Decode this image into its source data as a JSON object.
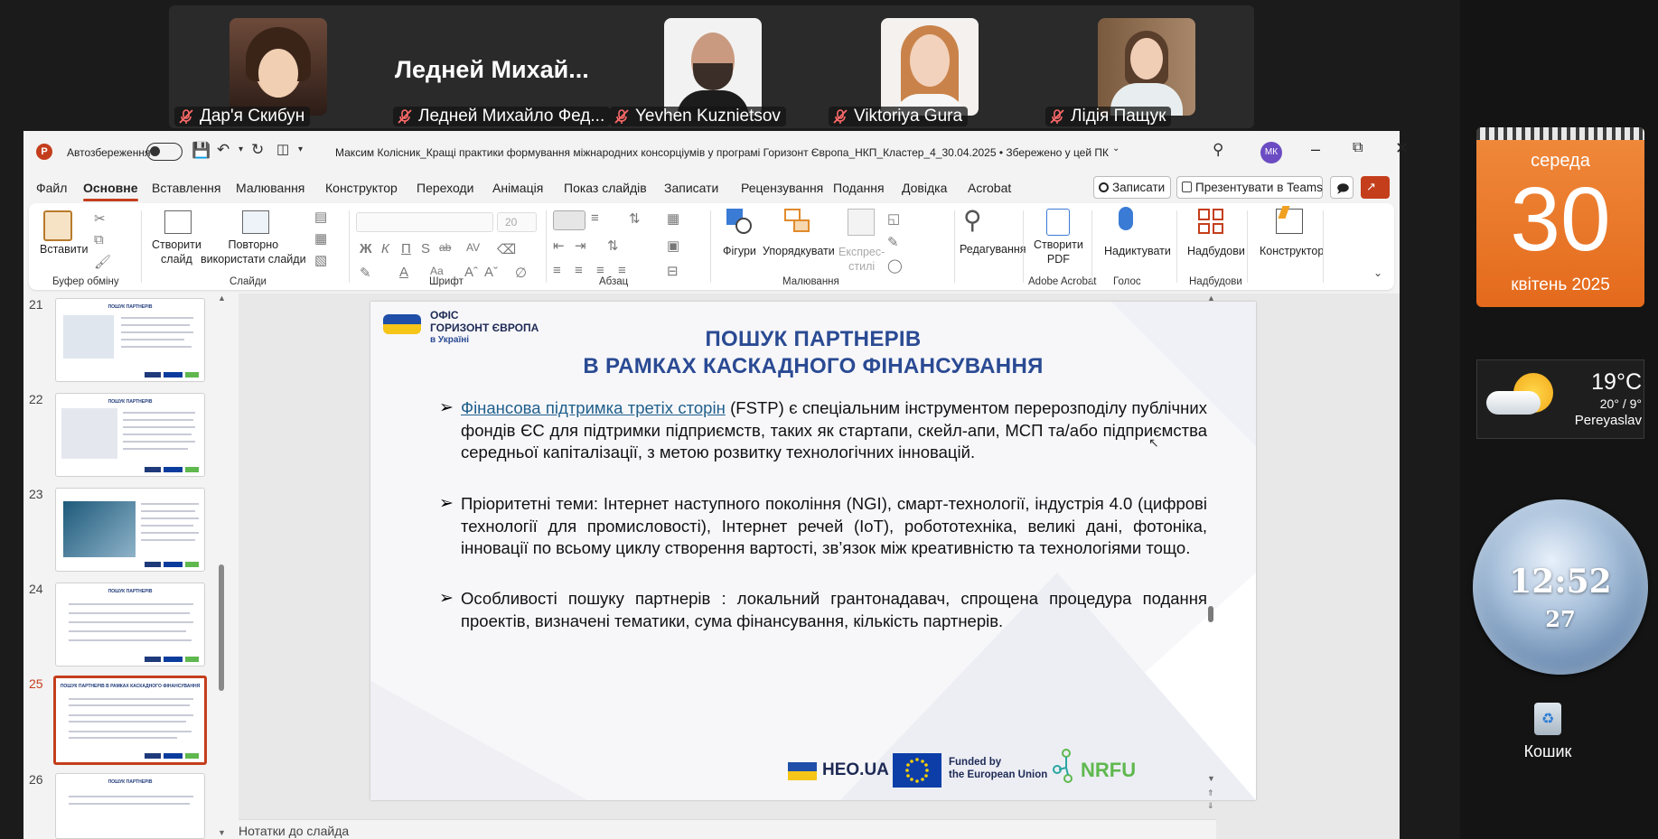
{
  "teams": {
    "participants": [
      {
        "name": "Дар'я Скибун"
      },
      {
        "name": "Ледней Михайло Фед...",
        "big_name": "Ледней  Михай..."
      },
      {
        "name": "Yevhen Kuznietsov"
      },
      {
        "name": "Viktoriya Gura"
      },
      {
        "name": "Лідія Пащук"
      }
    ]
  },
  "titlebar": {
    "autosave_label": "Автозбереження",
    "document_title": "Максим Колісник_Кращі практики формування міжнародних консорціумів у програмі Горизонт Європа_НКП_Кластер_4_30.04.2025 • Збережено у цей ПК",
    "user_initials": "МК"
  },
  "menu": {
    "items": [
      "Файл",
      "Основне",
      "Вставлення",
      "Малювання",
      "Конструктор",
      "Переходи",
      "Анімація",
      "Показ слайдів",
      "Записати",
      "Рецензування",
      "Подання",
      "Довідка",
      "Acrobat"
    ],
    "record_button": "Записати",
    "present_button": "Презентувати в Teams"
  },
  "ribbon": {
    "paste": "Вставити",
    "new_slide_1": "Створити",
    "new_slide_2": "слайд",
    "reuse_1": "Повторно",
    "reuse_2": "використати слайди",
    "font_size": "20",
    "shapes": "Фігури",
    "arrange": "Упорядкувати",
    "quick_styles_1": "Експрес-",
    "quick_styles_2": "стилі",
    "editing": "Редагування",
    "create_pdf_1": "Створити",
    "create_pdf_2": "PDF",
    "dictate": "Надиктувати",
    "addins": "Надбудови",
    "designer": "Конструктор",
    "groups": {
      "clipboard": "Буфер обміну",
      "slides": "Слайди",
      "font": "Шрифт",
      "paragraph": "Абзац",
      "drawing": "Малювання",
      "acrobat": "Adobe Acrobat",
      "voice": "Голос",
      "addins": "Надбудови"
    }
  },
  "slides_panel": {
    "numbers": [
      "21",
      "22",
      "23",
      "24",
      "25",
      "26"
    ],
    "selected": "25",
    "thumb_titles": [
      "ПОШУК ПАРТНЕРІВ",
      "ПОШУК ПАРТНЕРІВ",
      "",
      "ПОШУК ПАРТНЕРІВ",
      "ПОШУК ПАРТНЕРІВ В РАМКАХ КАСКАДНОГО ФІНАНСУВАННЯ",
      "ПОШУК ПАРТНЕРІВ"
    ]
  },
  "slide": {
    "logo_line1": "ОФІС",
    "logo_line2": "ГОРИЗОНТ ЄВРОПА",
    "logo_line3": "в Україні",
    "title_line1": "ПОШУК ПАРТНЕРІВ",
    "title_line2": "В РАМКАХ КАСКАДНОГО  ФІНАНСУВАННЯ",
    "bullet1_link": "Фінансова підтримка третіх сторін",
    "bullet1_rest": " (FSTP) є спеціальним інструментом перерозподілу публічних фондів ЄС для підтримки підприємств, таких як стартапи, скейл-апи, МСП та/або підприємства середньої капіталізації, з метою розвитку технологічних інновацій.",
    "bullet2": "Пріоритетні теми: Інтернет наступного покоління (NGI), смарт-технології, індустрія 4.0 (цифрові технології для промисловості), Інтернет речей (IoT), робототехніка, великі дані, фотоніка, інновації по всьому циклу створення вартості, зв’язок між креативністю та технологіями тощо.",
    "bullet3": "Особливості пошуку партнерів : локальний грантонадавач, спрощена процедура подання проектів, визначені тематики, сума фінансування, кількість партнерів.",
    "footer_heo": "HEO.UA",
    "footer_funded1": "Funded by",
    "footer_funded2": "the European Union",
    "footer_nrfu": "NRFU"
  },
  "notes": {
    "placeholder": "Нотатки до слайда"
  },
  "desktop": {
    "weekday": "середа",
    "day": "30",
    "month_year": "квітень 2025",
    "temp": "19°C",
    "temp_range": "20° / 9°",
    "city": "Pereyaslav",
    "time": "12:52",
    "seconds": "27",
    "recycle_bin": "Кошик"
  },
  "colors": {
    "accent": "#c43e1c",
    "slide_title": "#2a4a93",
    "calendar": "#e8751f"
  }
}
